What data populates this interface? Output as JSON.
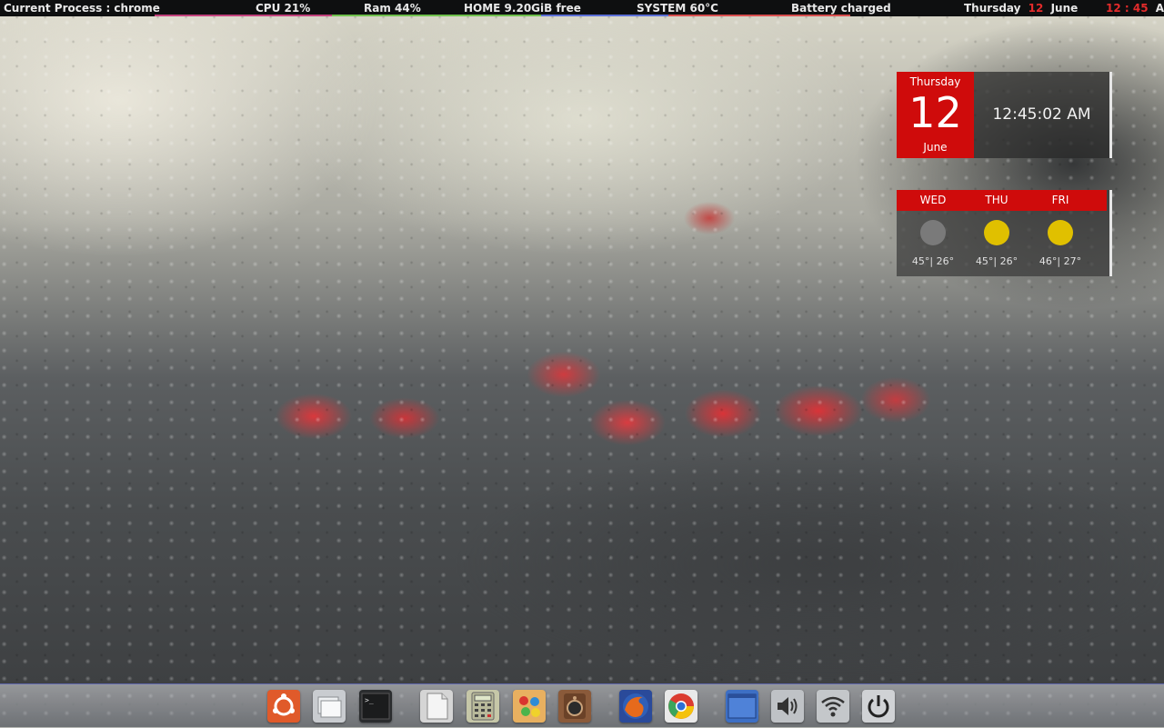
{
  "top_panel": {
    "process": "Current Process : chrome",
    "cpu": "CPU 21%",
    "ram": "Ram 44%",
    "home": "HOME  9.20GiB free",
    "system": "SYSTEM 60°C",
    "battery": "Battery charged",
    "date_weekday": "Thursday",
    "date_day": "12",
    "date_month": "June",
    "time_hours": "12",
    "time_sep": ":",
    "time_minutes": "45",
    "time_ampm": "AM",
    "underline_colors": {
      "cpu": "#c2417c",
      "ram": "#6fc04c",
      "home": "#5b6fd6",
      "system": "#d84e4e"
    }
  },
  "clock_widget": {
    "weekday": "Thursday",
    "day": "12",
    "month": "June",
    "time": "12:45:02 AM",
    "accent": "#cf0b0b"
  },
  "weather_widget": {
    "days": [
      {
        "label": "WED",
        "temps": "45°| 26°",
        "icon": "moon-icon",
        "icon_color": "#7a7a7a"
      },
      {
        "label": "THU",
        "temps": "45°| 26°",
        "icon": "sun-icon",
        "icon_color": "#e0c000"
      },
      {
        "label": "FRI",
        "temps": "46°| 27°",
        "icon": "sun-icon",
        "icon_color": "#e0c000"
      }
    ]
  },
  "dock": {
    "items": [
      {
        "name": "ubuntu-icon",
        "color": "#e05a2a"
      },
      {
        "name": "file-manager-icon",
        "color": "#c9ccd0"
      },
      {
        "name": "terminal-icon",
        "color": "#2a2c2e"
      },
      {
        "name": "text-editor-icon",
        "color": "#e9e9e9"
      },
      {
        "name": "calculator-icon",
        "color": "#c6c7a8"
      },
      {
        "name": "paint-icon",
        "color": "#e8b060"
      },
      {
        "name": "audio-player-icon",
        "color": "#8a5a3a"
      },
      {
        "name": "firefox-icon",
        "color": "#e66a1c"
      },
      {
        "name": "chrome-icon",
        "color": "#2d6fd6"
      },
      {
        "name": "workspace-icon",
        "color": "#3d6fc4"
      },
      {
        "name": "volume-icon",
        "color": "#bfc2c6"
      },
      {
        "name": "wifi-icon",
        "color": "#c4c7ca"
      },
      {
        "name": "power-icon",
        "color": "#d0d2d5"
      }
    ]
  }
}
